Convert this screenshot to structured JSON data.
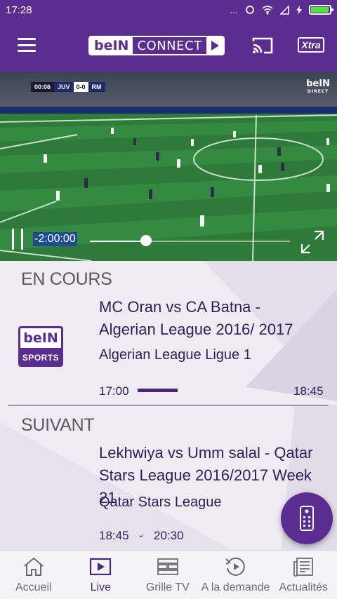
{
  "status_bar": {
    "time": "17:28",
    "dots": "...",
    "icons": [
      "sync-icon",
      "wifi-icon",
      "signal-icon",
      "charging-icon",
      "battery-icon"
    ]
  },
  "app_bar": {
    "logo": {
      "bein": "beIN",
      "connect": "CONNECT"
    },
    "xtra": "Xtra",
    "icons": [
      "menu-icon",
      "cast-icon",
      "xtra-icon"
    ]
  },
  "player": {
    "scorebug": {
      "clock": "00:06",
      "home": "JUV",
      "score": "0-0",
      "away": "RM"
    },
    "watermark": {
      "brand": "beIN",
      "sub": "DIRECT"
    },
    "timecode": "-2:00:00",
    "progress": 0.28,
    "icons": [
      "pause-icon",
      "fullscreen-icon"
    ]
  },
  "now": {
    "section": "EN COURS",
    "title": "MC Oran vs CA Batna - Algerian League 2016/ 2017",
    "subtitle": "Algerian League  Ligue 1",
    "start": "17:00",
    "end": "18:45",
    "progress": 0.27,
    "channel": {
      "top": "beIN",
      "bottom": "SPORTS"
    }
  },
  "next": {
    "section": "SUIVANT",
    "title": "Lekhwiya  vs Umm salal - Qatar Stars League 2016/2017 Week 21",
    "subtitle": "Qatar Stars League",
    "start": "18:45",
    "sep": "-",
    "end": "20:30"
  },
  "fab": {
    "icon": "remote-control-icon"
  },
  "nav": {
    "active": "live",
    "items": [
      {
        "label": "Accueil",
        "icon": "home-icon"
      },
      {
        "label": "Live",
        "icon": "live-play-icon"
      },
      {
        "label": "Grille TV",
        "icon": "tv-guide-icon"
      },
      {
        "label": "A la demande",
        "icon": "replay-icon"
      },
      {
        "label": "Actualités",
        "icon": "news-icon"
      }
    ]
  },
  "colors": {
    "brand": "#5c2d91",
    "pitch": "#2f7a3a",
    "text": "#341c58",
    "background": "#eeebf3"
  }
}
